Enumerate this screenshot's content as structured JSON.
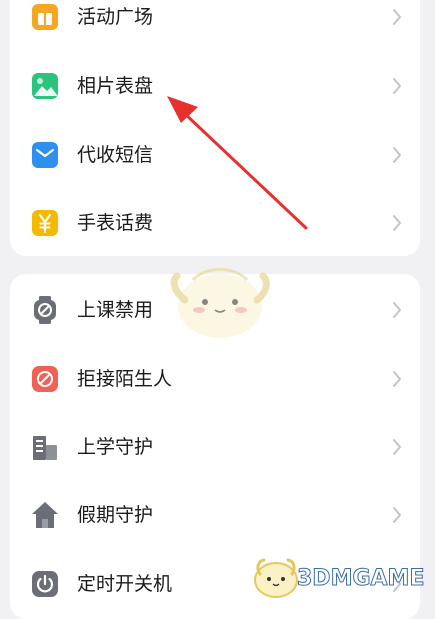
{
  "group1": {
    "items": [
      {
        "label": "活动广场",
        "icon": "gift-icon",
        "color": "#f5a623"
      },
      {
        "label": "相片表盘",
        "icon": "picture-icon",
        "color": "#2ac47c"
      },
      {
        "label": "代收短信",
        "icon": "message-icon",
        "color": "#2f8ff0"
      },
      {
        "label": "手表话费",
        "icon": "yuan-icon",
        "color": "#f5b900"
      }
    ]
  },
  "group2": {
    "items": [
      {
        "label": "上课禁用",
        "icon": "watch-block-icon",
        "color": "#6b6e76"
      },
      {
        "label": "拒接陌生人",
        "icon": "call-block-icon",
        "color": "#f06156"
      },
      {
        "label": "上学守护",
        "icon": "school-icon",
        "color": "#6b6e76"
      },
      {
        "label": "假期守护",
        "icon": "home-icon",
        "color": "#6b6e76"
      },
      {
        "label": "定时开关机",
        "icon": "power-icon",
        "color": "#6b6e76"
      }
    ]
  },
  "watermark": {
    "text": "3DMGAME"
  },
  "colors": {
    "arrow": "#e8302c",
    "background": "#f1f1f3"
  }
}
